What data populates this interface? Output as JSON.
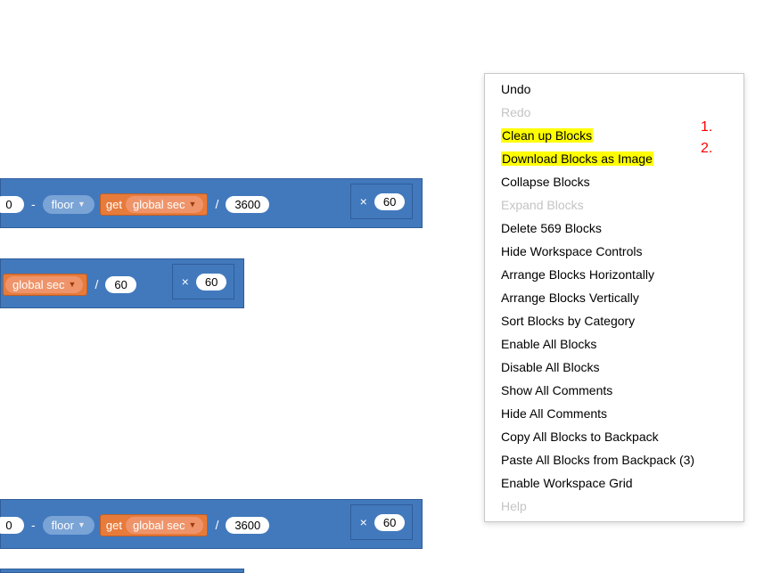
{
  "blocks": {
    "strip1": {
      "num0": "0",
      "minus": "-",
      "floor": "floor",
      "get": "get",
      "var": "global sec",
      "div": "/",
      "divisor": "3600",
      "times": "×",
      "sixty": "60"
    },
    "strip2": {
      "var": "global sec",
      "div": "/",
      "divisor": "60",
      "times": "×",
      "sixty": "60"
    },
    "strip3": {
      "num0": "0",
      "minus": "-",
      "floor": "floor",
      "get": "get",
      "var": "global sec",
      "div": "/",
      "divisor": "3600",
      "times": "×",
      "sixty": "60"
    }
  },
  "menu": {
    "undo": "Undo",
    "redo": "Redo",
    "cleanup": "Clean up Blocks",
    "download": "Download Blocks as Image",
    "collapse": "Collapse Blocks",
    "expand": "Expand Blocks",
    "delete": "Delete 569 Blocks",
    "hidectrl": "Hide Workspace Controls",
    "arr_h": "Arrange Blocks Horizontally",
    "arr_v": "Arrange Blocks Vertically",
    "sort": "Sort Blocks by Category",
    "enable_all": "Enable All Blocks",
    "disable_all": "Disable All Blocks",
    "show_c": "Show All Comments",
    "hide_c": "Hide All Comments",
    "copy_bp": "Copy All Blocks to Backpack",
    "paste_bp": "Paste All Blocks from Backpack (3)",
    "grid": "Enable Workspace Grid",
    "help": "Help"
  },
  "anno": {
    "one": "1.",
    "two": "2."
  }
}
